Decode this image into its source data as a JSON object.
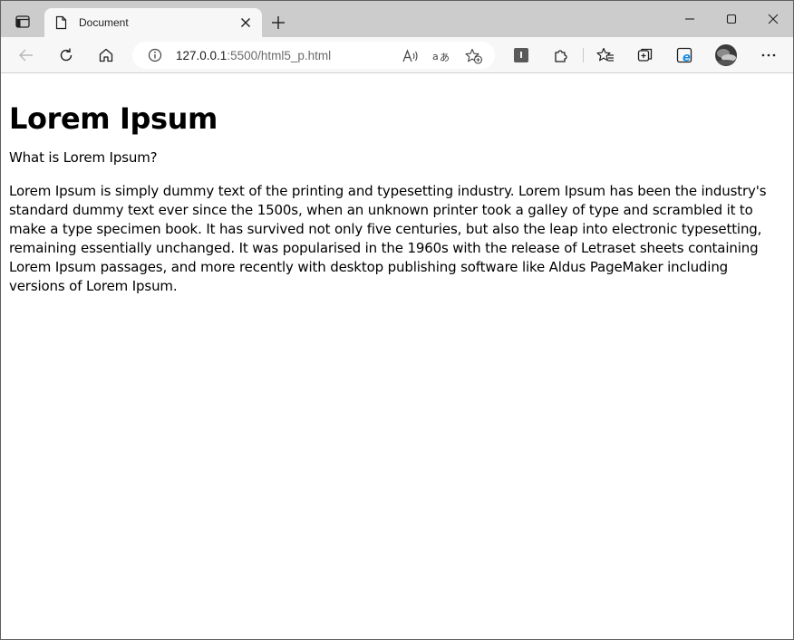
{
  "browser": {
    "tab_title": "Document",
    "url_host": "127.0.0.1",
    "url_path": ":5500/html5_p.html",
    "reader_label": "A⁾",
    "profile_badge": "I"
  },
  "page": {
    "heading": "Lorem Ipsum",
    "question": "What is Lorem Ipsum?",
    "body": "Lorem Ipsum is simply dummy text of the printing and typesetting industry. Lorem Ipsum has been the industry's standard dummy text ever since the 1500s, when an unknown printer took a galley of type and scrambled it to make a type specimen book. It has survived not only five centuries, but also the leap into electronic typesetting, remaining essentially unchanged. It was popularised in the 1960s with the release of Letraset sheets containing Lorem Ipsum passages, and more recently with desktop publishing software like Aldus PageMaker including versions of Lorem Ipsum."
  },
  "colors": {
    "tabstrip_bg": "#cccccc",
    "toolbar_bg": "#f7f7f7",
    "accent_edge": "#1a8ce0"
  },
  "icons": {
    "tab_actions": "tab-actions-icon",
    "page": "page-icon",
    "close_tab": "close-icon",
    "new_tab": "plus-icon",
    "back": "back-arrow-icon",
    "refresh": "refresh-icon",
    "home": "home-icon",
    "info": "info-icon",
    "read_aloud": "read-aloud-icon",
    "translate": "translate-icon",
    "favorite_add": "add-favorite-icon",
    "extension": "puzzle-icon",
    "favorites": "favorites-icon",
    "collections": "collections-icon",
    "ie_mode": "ie-mode-icon",
    "avatar": "avatar",
    "more": "more-icon"
  }
}
